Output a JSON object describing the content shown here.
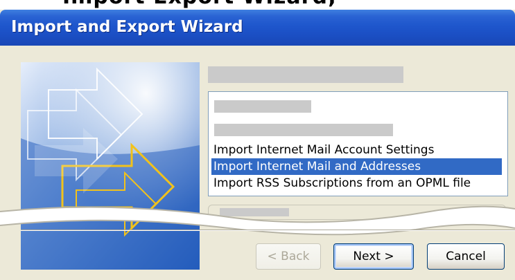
{
  "top_clipped_text": "Import Export Wizard;",
  "window": {
    "title": "Import and Export Wizard"
  },
  "list": {
    "items": [
      {
        "label": "Import Internet Mail Account Settings",
        "selected": false
      },
      {
        "label": "Import Internet Mail and Addresses",
        "selected": true
      },
      {
        "label": "Import RSS Subscriptions from an OPML file",
        "selected": false
      }
    ]
  },
  "buttons": {
    "back": "< Back",
    "next": "Next >",
    "cancel": "Cancel"
  },
  "colors": {
    "titlebar": "#1e56cc",
    "selection": "#316ac5",
    "art_accent": "#f2c21b"
  }
}
